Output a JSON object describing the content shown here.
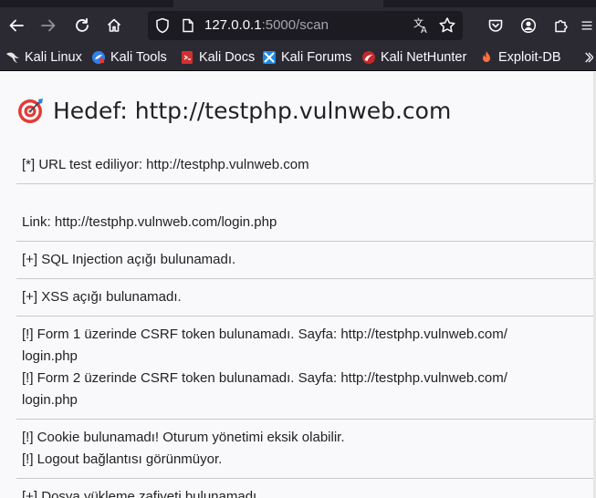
{
  "browser": {
    "url_host": "127.0.0.1",
    "url_rest": ":5000/scan"
  },
  "bookmarks": [
    {
      "label": "Kali Linux",
      "icon": "kali-dragon-icon"
    },
    {
      "label": "Kali Tools",
      "icon": "kali-tools-icon"
    },
    {
      "label": "Kali Docs",
      "icon": "kali-docs-icon"
    },
    {
      "label": "Kali Forums",
      "icon": "kali-forums-icon"
    },
    {
      "label": "Kali NetHunter",
      "icon": "kali-nethunter-icon"
    },
    {
      "label": "Exploit-DB",
      "icon": "exploit-db-icon"
    }
  ],
  "page": {
    "heading": "Hedef: http://testphp.vulnweb.com",
    "heading_icon": "target-icon",
    "results": {
      "testing": "[*] URL test ediliyor: http://testphp.vulnweb.com",
      "link": "Link: http://testphp.vulnweb.com/login.php",
      "sqli": "[+] SQL Injection açığı bulunamadı.",
      "xss": "[+] XSS açığı bulunamadı.",
      "csrf_1a": "[!] Form 1 üzerinde CSRF token bulunamadı. Sayfa: http://testphp.vulnweb.com/",
      "csrf_1b": "login.php",
      "csrf_2a": "[!] Form 2 üzerinde CSRF token bulunamadı. Sayfa: http://testphp.vulnweb.com/",
      "csrf_2b": "login.php",
      "cookie": "[!] Cookie bulunamadı! Oturum yönetimi eksik olabilir.",
      "logout": "[!] Logout bağlantısı görünmüyor.",
      "upload": "[+] Dosya yükleme zafiyeti bulunamadı."
    }
  },
  "colors": {
    "chrome_bg": "#2b2a33",
    "urlbar_bg": "#1c1b22",
    "page_bg": "#f9f9fb",
    "text": "#222222",
    "divider": "#c9c9c9"
  }
}
